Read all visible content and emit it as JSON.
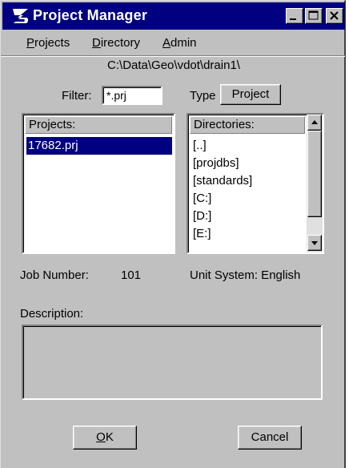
{
  "window": {
    "title": "Project Manager",
    "accent": "#000080"
  },
  "menu": {
    "projects_rest": "rojects",
    "projects_key": "P",
    "directory_rest": "irectory",
    "directory_key": "D",
    "admin_rest": "dmin",
    "admin_key": "A"
  },
  "path": "C:\\Data\\Geo\\vdot\\drain1\\",
  "filter": {
    "label": "Filter:",
    "value": "*.prj"
  },
  "type": {
    "label": "Type",
    "value": "Project"
  },
  "projects": {
    "header": "Projects:",
    "items": [
      "17682.prj"
    ],
    "selected": 0
  },
  "directories": {
    "header": "Directories:",
    "items": [
      "[..]",
      "[projdbs]",
      "[standards]",
      "[C:]",
      "[D:]",
      "[E:]"
    ]
  },
  "job": {
    "label": "Job Number:",
    "value": "101"
  },
  "unit": {
    "text": "Unit System: English"
  },
  "description": {
    "label": "Description:"
  },
  "buttons": {
    "ok_key": "O",
    "ok_rest": "K",
    "cancel": "Cancel"
  }
}
